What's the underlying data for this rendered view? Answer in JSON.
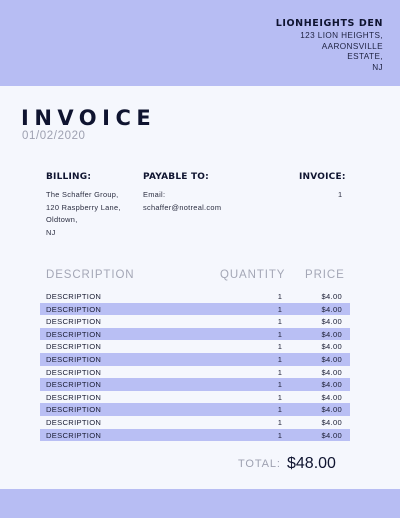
{
  "company": {
    "name": "LIONHEIGHTS DEN",
    "address_lines": [
      "123 LION HEIGHTS,",
      "AARONSVILLE",
      "ESTATE,",
      "NJ"
    ]
  },
  "invoice": {
    "title": "INVOICE",
    "date": "01/02/2020"
  },
  "billing": {
    "heading": "BILLING:",
    "lines": [
      "The Schaffer Group,",
      "120 Raspberry Lane,",
      "Oldtown,",
      "NJ"
    ]
  },
  "payable": {
    "heading": "PAYABLE TO:",
    "lines": [
      "Email:",
      "schaffer@notreal.com"
    ]
  },
  "invoice_no": {
    "heading": "INVOICE:",
    "value": "1"
  },
  "table": {
    "headers": {
      "description": "DESCRIPTION",
      "quantity": "QUANTITY",
      "price": "PRICE"
    },
    "rows": [
      {
        "description": "DESCRIPTION",
        "quantity": "1",
        "price": "$4.00"
      },
      {
        "description": "DESCRIPTION",
        "quantity": "1",
        "price": "$4.00"
      },
      {
        "description": "DESCRIPTION",
        "quantity": "1",
        "price": "$4.00"
      },
      {
        "description": "DESCRIPTION",
        "quantity": "1",
        "price": "$4.00"
      },
      {
        "description": "DESCRIPTION",
        "quantity": "1",
        "price": "$4.00"
      },
      {
        "description": "DESCRIPTION",
        "quantity": "1",
        "price": "$4.00"
      },
      {
        "description": "DESCRIPTION",
        "quantity": "1",
        "price": "$4.00"
      },
      {
        "description": "DESCRIPTION",
        "quantity": "1",
        "price": "$4.00"
      },
      {
        "description": "DESCRIPTION",
        "quantity": "1",
        "price": "$4.00"
      },
      {
        "description": "DESCRIPTION",
        "quantity": "1",
        "price": "$4.00"
      },
      {
        "description": "DESCRIPTION",
        "quantity": "1",
        "price": "$4.00"
      },
      {
        "description": "DESCRIPTION",
        "quantity": "1",
        "price": "$4.00"
      }
    ]
  },
  "total": {
    "label": "TOTAL:",
    "value": "$48.00"
  },
  "colors": {
    "accent": "#b7bdf3",
    "row_alt": "#b9bff4",
    "background": "#f5f7fd",
    "text": "#0f1430",
    "muted": "#9ea1b1"
  }
}
